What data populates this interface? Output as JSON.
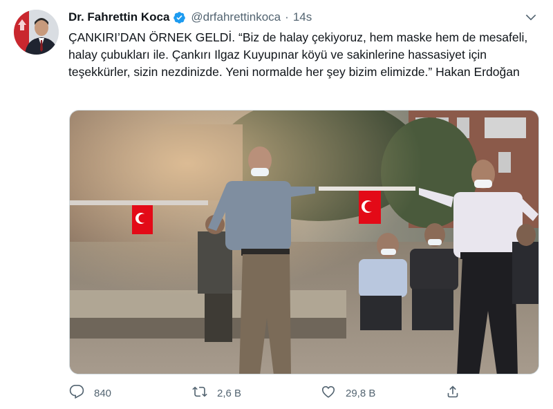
{
  "tweet": {
    "author": {
      "display_name": "Dr. Fahrettin Koca",
      "handle": "@drfahrettinkoca",
      "verified": true
    },
    "separator": "·",
    "time": "14s",
    "text": "ÇANKIRI’DAN ÖRNEK GELDİ. “Biz de halay çekiyoruz, hem maske hem de mesafeli, halay çubukları ile. Çankırı Ilgaz Kuyupınar köyü ve sakinlerine hassasiyet için teşekkürler, sizin nezdinizde. Yeni normalde her şey bizim elimizde.” Hakan Erdoğan",
    "stats": {
      "replies": "840",
      "retweets": "2,6 B",
      "likes": "29,8 B"
    }
  },
  "icons": {
    "verified": "verified-badge-icon",
    "caret": "chevron-down-icon",
    "reply": "reply-icon",
    "retweet": "retweet-icon",
    "like": "heart-icon",
    "share": "share-icon"
  },
  "colors": {
    "verified_blue": "#1d9bf0",
    "secondary_text": "#536471",
    "primary_text": "#0f1419",
    "flag_red": "#e30a17"
  }
}
